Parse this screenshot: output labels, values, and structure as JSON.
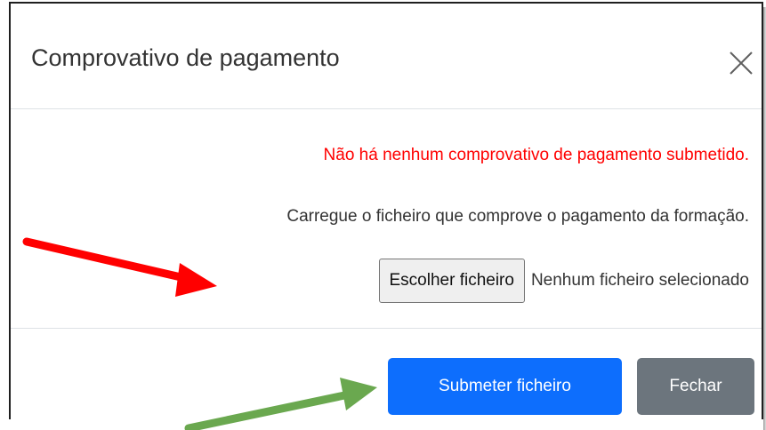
{
  "modal": {
    "title": "Comprovativo de pagamento",
    "close_icon": "close-icon"
  },
  "body": {
    "error_message": "Não há nenhum comprovativo de pagamento submetido.",
    "instruction": "Carregue o ficheiro que comprove o pagamento da formação.",
    "file_button_label": "Escolher ficheiro",
    "file_status": "Nenhum ficheiro selecionado"
  },
  "footer": {
    "submit_label": "Submeter ficheiro",
    "close_label": "Fechar"
  },
  "annotations": {
    "red_arrow_color": "#ff0000",
    "green_arrow_color": "#6aa84f"
  },
  "colors": {
    "error": "#ff0000",
    "primary": "#0d6efd",
    "secondary": "#6c757d"
  }
}
